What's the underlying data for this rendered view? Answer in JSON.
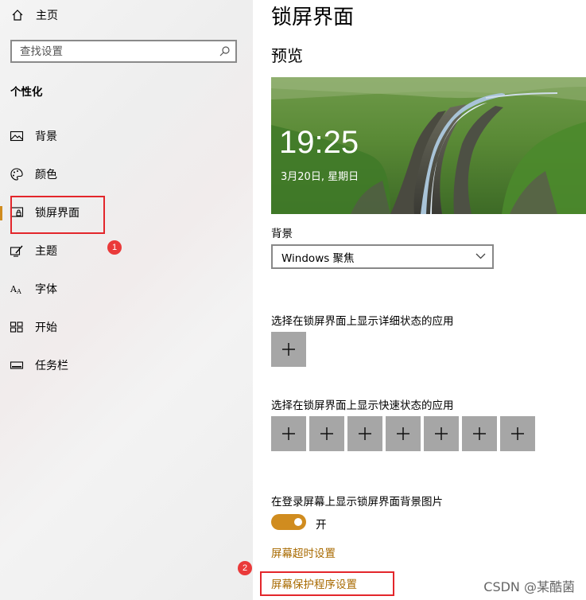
{
  "sidebar": {
    "home_label": "主页",
    "search_placeholder": "查找设置",
    "section_title": "个性化",
    "items": [
      {
        "label": "背景",
        "icon": "picture-icon"
      },
      {
        "label": "颜色",
        "icon": "palette-icon"
      },
      {
        "label": "锁屏界面",
        "icon": "lock-screen-icon",
        "active": true
      },
      {
        "label": "主题",
        "icon": "theme-brush-icon"
      },
      {
        "label": "字体",
        "icon": "font-icon"
      },
      {
        "label": "开始",
        "icon": "start-grid-icon"
      },
      {
        "label": "任务栏",
        "icon": "taskbar-icon"
      }
    ]
  },
  "annotations": {
    "badge1": "1",
    "badge2": "2"
  },
  "main": {
    "title": "锁屏界面",
    "preview_title": "预览",
    "preview_time": "19:25",
    "preview_date": "3月20日, 星期日",
    "background_label": "背景",
    "background_value": "Windows 聚焦",
    "detailed_status_label": "选择在锁屏界面上显示详细状态的应用",
    "quick_status_label": "选择在锁屏界面上显示快速状态的应用",
    "quick_status_slot_count": 7,
    "signin_bg_label": "在登录屏幕上显示锁屏界面背景图片",
    "toggle_state": "开",
    "toggle_on": true,
    "link_timeout": "屏幕超时设置",
    "link_screensaver": "屏幕保护程序设置"
  },
  "watermark": "CSDN @某酷菌",
  "colors": {
    "accent": "#d08c1f",
    "link": "#a86a00",
    "annotation_red": "#e3262b",
    "tile": "#a6a6a6"
  }
}
